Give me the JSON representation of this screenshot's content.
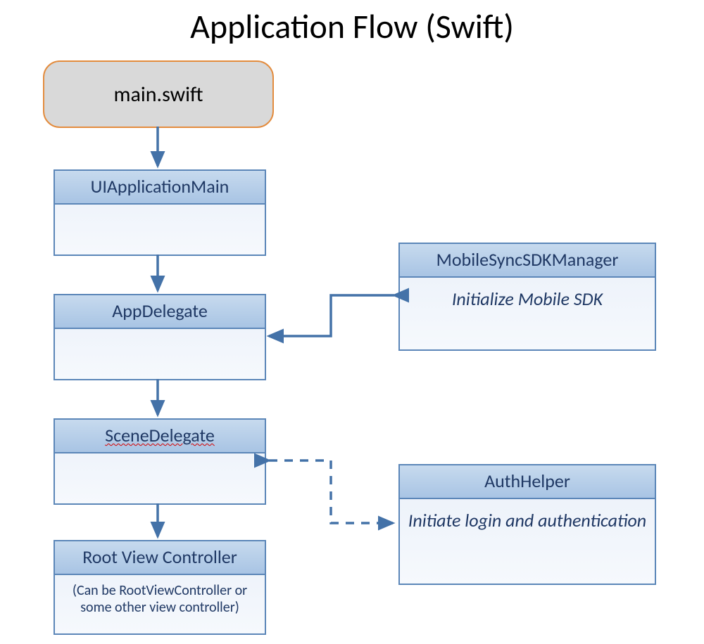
{
  "title": "Application Flow (Swift)",
  "nodes": {
    "main_swift": {
      "label": "main.swift"
    },
    "ui_app_main": {
      "header": "UIApplicationMain"
    },
    "app_delegate": {
      "header": "AppDelegate"
    },
    "scene_delegate": {
      "header": "SceneDelegate"
    },
    "root_vc": {
      "header": "Root View Controller",
      "body": "(Can be RootViewController or some other view controller)"
    },
    "mobile_sync": {
      "header": "MobileSyncSDKManager",
      "body": "Initialize Mobile SDK"
    },
    "auth_helper": {
      "header": "AuthHelper",
      "body": "Initiate login and authentication"
    }
  },
  "colors": {
    "arrow": "#4472a8",
    "node_border": "#5b86b8",
    "start_border": "#e38c3e",
    "start_fill": "#d9d9d9"
  },
  "arrows": [
    {
      "from": "main_swift",
      "to": "ui_app_main",
      "style": "solid",
      "direction": "down"
    },
    {
      "from": "ui_app_main",
      "to": "app_delegate",
      "style": "solid",
      "direction": "down"
    },
    {
      "from": "app_delegate",
      "to": "scene_delegate",
      "style": "solid",
      "direction": "down"
    },
    {
      "from": "scene_delegate",
      "to": "root_vc",
      "style": "solid",
      "direction": "down"
    },
    {
      "from": "app_delegate",
      "to": "mobile_sync",
      "style": "solid",
      "direction": "bidirectional"
    },
    {
      "from": "scene_delegate",
      "to": "auth_helper",
      "style": "dashed",
      "direction": "bidirectional"
    }
  ]
}
